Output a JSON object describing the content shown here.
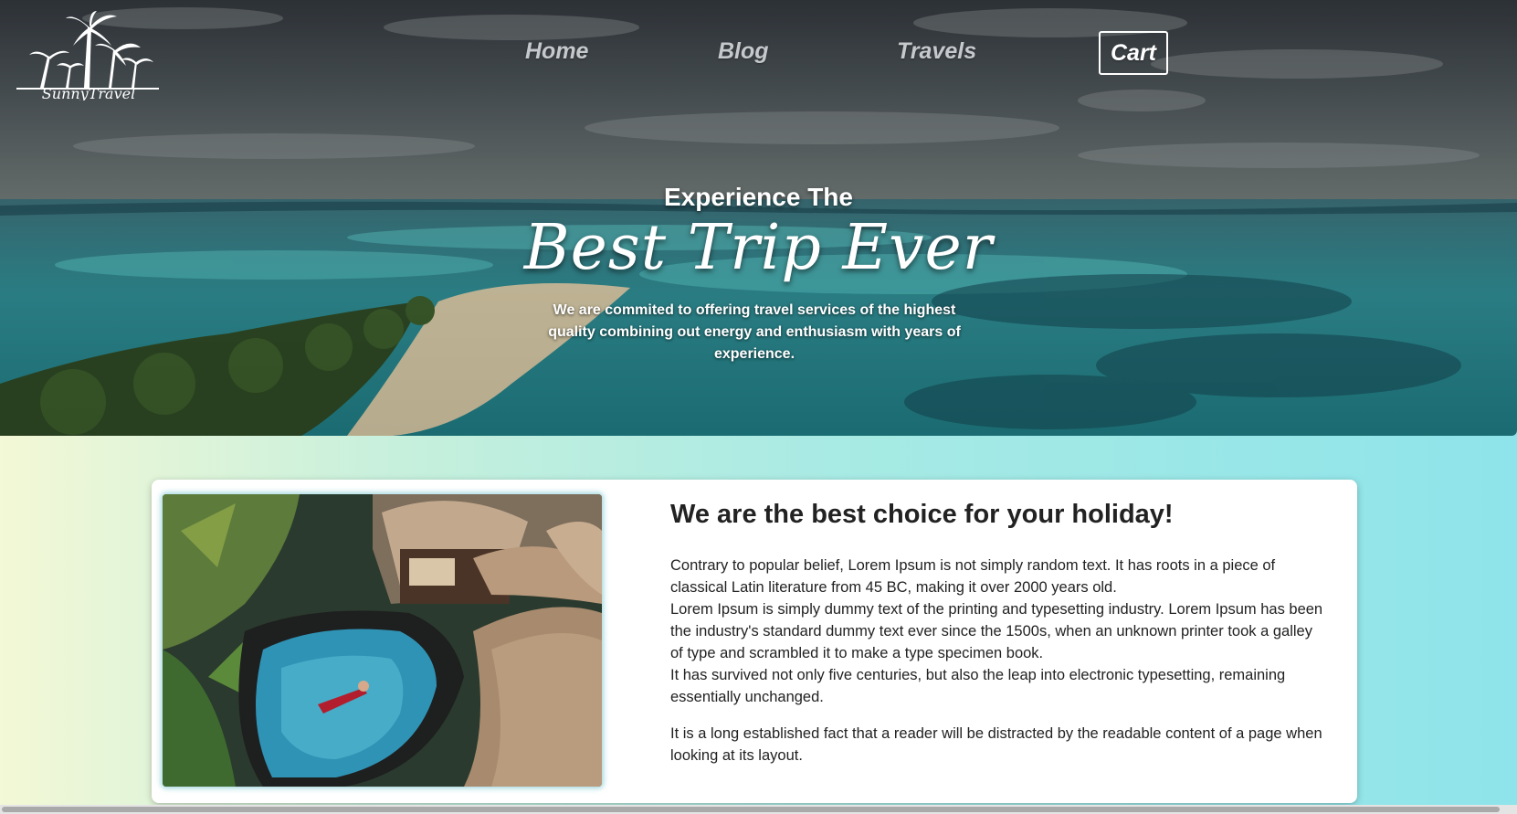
{
  "brand": {
    "logo_text": "SunnyTravel"
  },
  "nav": {
    "items": [
      {
        "label": "Home"
      },
      {
        "label": "Blog"
      },
      {
        "label": "Travels"
      }
    ],
    "cart_label": "Cart"
  },
  "hero": {
    "kicker": "Experience The",
    "title": "Best Trip Ever",
    "description": "We are commited to offering travel services of the highest quality combining out energy and enthusiasm with years of experience."
  },
  "about": {
    "title": "We are the best choice for your holiday!",
    "paragraph_1_line_1": "Contrary to popular belief, Lorem Ipsum is not simply random text. It has roots in a piece of classical Latin literature from 45 BC, making it over 2000 years old.",
    "paragraph_1_line_2": "Lorem Ipsum is simply dummy text of the printing and typesetting industry. Lorem Ipsum has been the industry's standard dummy text ever since the 1500s, when an unknown printer took a galley of type and scrambled it to make a type specimen book.",
    "paragraph_1_line_3": "It has survived not only five centuries, but also the leap into electronic typesetting, remaining essentially unchanged.",
    "paragraph_2": "It is a long established fact that a reader will be distracted by the readable content of a page when looking at its layout."
  },
  "colors": {
    "page_gradient_start": "#f3f8d6",
    "page_gradient_end": "#8ee4ea",
    "nav_text": "#c6c9cc",
    "heading_text": "#222222"
  },
  "icons": {
    "logo": "palm-trees-logo-icon"
  }
}
